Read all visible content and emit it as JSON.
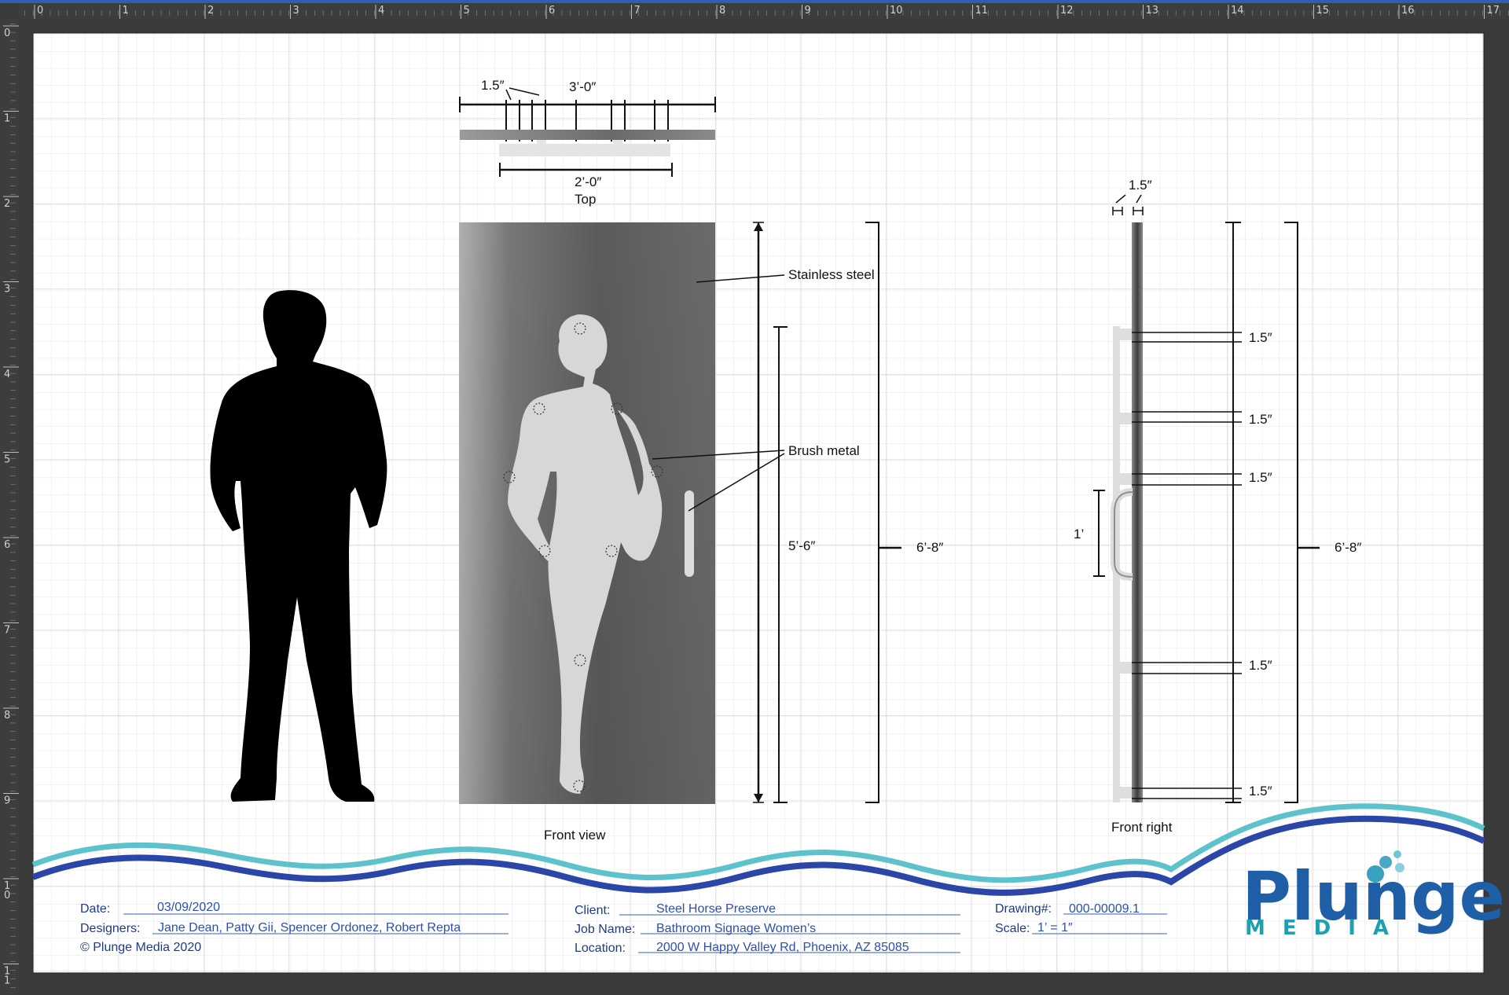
{
  "ruler": {
    "top": [
      "0",
      "1",
      "2",
      "3",
      "4",
      "5",
      "6",
      "7",
      "8",
      "9",
      "10",
      "11",
      "12",
      "13",
      "14",
      "15",
      "16",
      "17"
    ],
    "left": [
      "0",
      "1",
      "2",
      "3",
      "4",
      "5",
      "6",
      "7",
      "8",
      "9",
      "10",
      "11"
    ]
  },
  "top_view": {
    "dim_gap": "1.5″",
    "dim_width": "3’-0″",
    "dim_span": "2’-0″",
    "caption": "Top"
  },
  "front_view": {
    "caption": "Front view",
    "callout_stainless": "Stainless steel",
    "callout_brush": "Brush metal",
    "dim_height_inner": "5’-6″",
    "dim_height_outer": "6’-8″"
  },
  "side_view": {
    "caption": "Front right",
    "dim_thickness": "1.5″",
    "dim_standoff": "1.5″",
    "dim_handle": "1’",
    "dim_height": "6’-8″"
  },
  "title_block": {
    "date_label": "Date:",
    "date_value": "03/09/2020",
    "designers_label": "Designers:",
    "designers_value": "Jane Dean, Patty Gii, Spencer Ordonez, Robert Repta",
    "copyright": "© Plunge  Media 2020",
    "client_label": "Client:",
    "client_value": "Steel Horse Preserve",
    "job_label": "Job Name:",
    "job_value": "Bathroom Signage Women’s",
    "location_label": "Location:",
    "location_value": "2000 W Happy Valley Rd, Phoenix, AZ 85085",
    "drawing_label": "Drawing#:",
    "drawing_value": "000-00009.1",
    "scale_label": "Scale:",
    "scale_value": "1’ = 1″"
  },
  "logo": {
    "word": "Plunge",
    "sub": "MEDIA"
  },
  "colors": {
    "wave_light": "#5ec2cc",
    "wave_dark": "#2c46a8",
    "title_text": "#1f3a8c",
    "panel_dark": "#5a5a5a",
    "panel_light": "#b8b8b8"
  }
}
